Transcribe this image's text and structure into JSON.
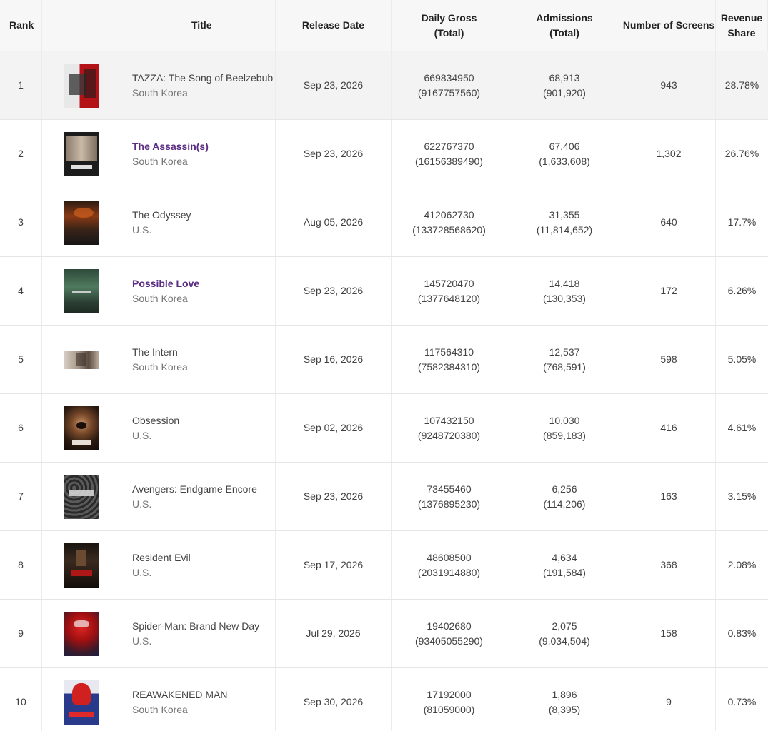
{
  "header": {
    "rank": "Rank",
    "title": "Title",
    "release_date": "Release Date",
    "daily_gross_1": "Daily Gross",
    "daily_gross_2": "(Total)",
    "admissions_1": "Admissions",
    "admissions_2": "(Total)",
    "screens": "Number of Screens",
    "share_1": "Revenue",
    "share_2": "Share"
  },
  "rows": [
    {
      "rank": "1",
      "title": "TAZZA: The Song of Beelzebub",
      "country": "South Korea",
      "release": "Sep 23, 2026",
      "gross": "669834950",
      "gross_total": "(9167757560)",
      "adm": "68,913",
      "adm_total": "(901,920)",
      "screens": "943",
      "share": "28.78%"
    },
    {
      "rank": "2",
      "title": "The Assassin(s)",
      "country": "South Korea",
      "release": "Sep 23, 2026",
      "gross": "622767370",
      "gross_total": "(16156389490)",
      "adm": "67,406",
      "adm_total": "(1,633,608)",
      "screens": "1,302",
      "share": "26.76%"
    },
    {
      "rank": "3",
      "title": "The Odyssey",
      "country": "U.S.",
      "release": "Aug 05, 2026",
      "gross": "412062730",
      "gross_total": "(133728568620)",
      "adm": "31,355",
      "adm_total": "(11,814,652)",
      "screens": "640",
      "share": "17.7%"
    },
    {
      "rank": "4",
      "title": "Possible Love",
      "country": "South Korea",
      "release": "Sep 23, 2026",
      "gross": "145720470",
      "gross_total": "(1377648120)",
      "adm": "14,418",
      "adm_total": "(130,353)",
      "screens": "172",
      "share": "6.26%"
    },
    {
      "rank": "5",
      "title": "The Intern",
      "country": "South Korea",
      "release": "Sep 16, 2026",
      "gross": "117564310",
      "gross_total": "(7582384310)",
      "adm": "12,537",
      "adm_total": "(768,591)",
      "screens": "598",
      "share": "5.05%"
    },
    {
      "rank": "6",
      "title": "Obsession",
      "country": "U.S.",
      "release": "Sep 02, 2026",
      "gross": "107432150",
      "gross_total": "(9248720380)",
      "adm": "10,030",
      "adm_total": "(859,183)",
      "screens": "416",
      "share": "4.61%"
    },
    {
      "rank": "7",
      "title": "Avengers: Endgame Encore",
      "country": "U.S.",
      "release": "Sep 23, 2026",
      "gross": "73455460",
      "gross_total": "(1376895230)",
      "adm": "6,256",
      "adm_total": "(114,206)",
      "screens": "163",
      "share": "3.15%"
    },
    {
      "rank": "8",
      "title": "Resident Evil",
      "country": "U.S.",
      "release": "Sep 17, 2026",
      "gross": "48608500",
      "gross_total": "(2031914880)",
      "adm": "4,634",
      "adm_total": "(191,584)",
      "screens": "368",
      "share": "2.08%"
    },
    {
      "rank": "9",
      "title": "Spider-Man: Brand New Day",
      "country": "U.S.",
      "release": "Jul 29, 2026",
      "gross": "19402680",
      "gross_total": "(93405055290)",
      "adm": "2,075",
      "adm_total": "(9,034,504)",
      "screens": "158",
      "share": "0.83%"
    },
    {
      "rank": "10",
      "title": "REAWAKENED MAN",
      "country": "South Korea",
      "release": "Sep 30, 2026",
      "gross": "17192000",
      "gross_total": "(81059000)",
      "adm": "1,896",
      "adm_total": "(8,395)",
      "screens": "9",
      "share": "0.73%"
    }
  ]
}
